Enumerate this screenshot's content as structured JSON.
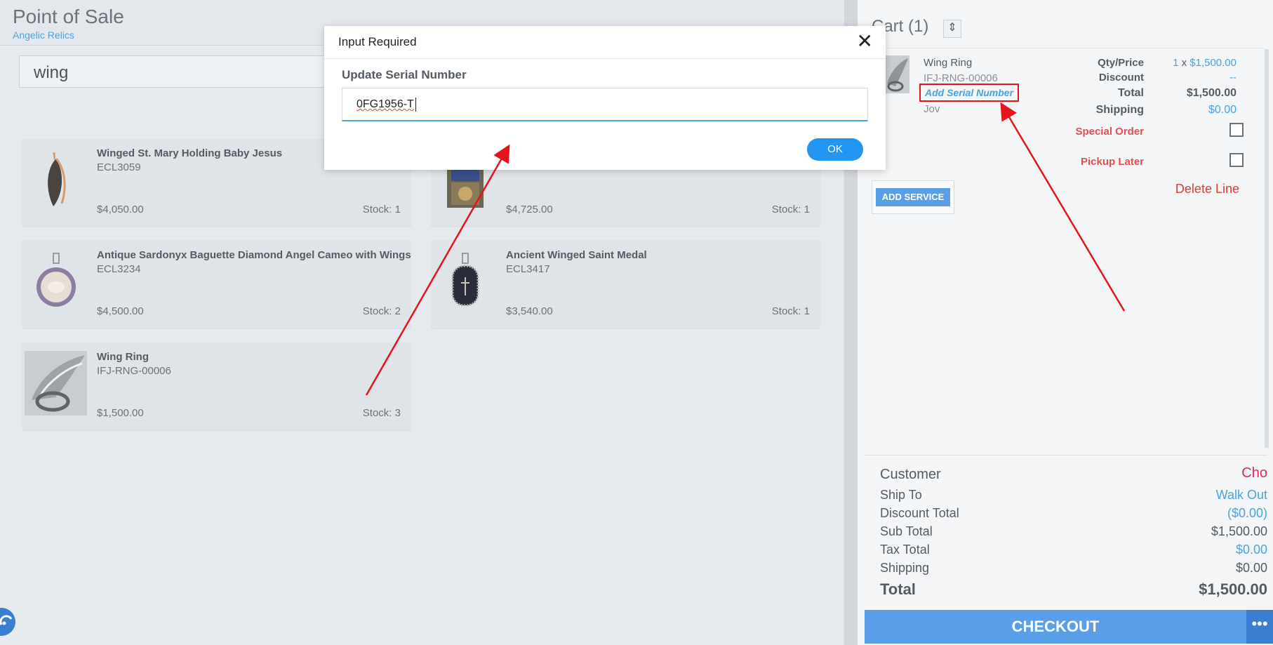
{
  "header": {
    "title": "Point of Sale",
    "subtitle": "Angelic Relics"
  },
  "search": {
    "value": "wing"
  },
  "products": [
    {
      "name": "Winged St. Mary Holding Baby Jesus",
      "sku": "ECL3059",
      "price": "$4,050.00",
      "stock": "Stock: 1",
      "image": "winged-pendant-image"
    },
    {
      "name": "",
      "sku": "",
      "price": "$4,725.00",
      "stock": "Stock: 1",
      "image": "icon-pendant-image"
    },
    {
      "name": "Antique Sardonyx Baguette Diamond Angel Cameo with Wings",
      "sku": "ECL3234",
      "price": "$4,500.00",
      "stock": "Stock: 2",
      "image": "cameo-pendant-image"
    },
    {
      "name": "Ancient Winged Saint Medal",
      "sku": "ECL3417",
      "price": "$3,540.00",
      "stock": "Stock: 1",
      "image": "saint-medal-image"
    },
    {
      "name": "Wing Ring",
      "sku": "IFJ-RNG-00006",
      "price": "$1,500.00",
      "stock": "Stock: 3",
      "image": "wing-ring-image"
    }
  ],
  "cart": {
    "title": "Cart (1)",
    "line": {
      "name": "Wing Ring",
      "sku": "IFJ-RNG-00006",
      "add_serial": "Add Serial Number",
      "vendor": "Jov",
      "qty_price_label": "Qty/Price",
      "qty": "1",
      "times": "x",
      "unit_price": "$1,500.00",
      "discount_label": "Discount",
      "discount_value": "--",
      "total_label": "Total",
      "total_value": "$1,500.00",
      "shipping_label": "Shipping",
      "shipping_value": "$0.00",
      "special_order_label": "Special Order",
      "pickup_later_label": "Pickup Later",
      "add_service": "ADD SERVICE",
      "delete_line": "Delete Line"
    },
    "summary": {
      "customer_label": "Customer",
      "customer_value": "Cho",
      "ship_to_label": "Ship To",
      "ship_to_value": "Walk Out",
      "discount_total_label": "Discount Total",
      "discount_total_value": "($0.00)",
      "sub_total_label": "Sub Total",
      "sub_total_value": "$1,500.00",
      "tax_total_label": "Tax Total",
      "tax_total_value": "$0.00",
      "shipping_label": "Shipping",
      "shipping_value": "$0.00",
      "total_label": "Total",
      "total_value": "$1,500.00"
    },
    "checkout": "CHECKOUT",
    "more": "•••"
  },
  "modal": {
    "title": "Input Required",
    "close": "✕",
    "field_label": "Update Serial Number",
    "field_value": "0FG1956-T",
    "ok": "OK"
  },
  "colors": {
    "accent": "#4aa3df",
    "checkout": "#5b9ee8",
    "ok_button": "#2196f3",
    "danger": "#e03a3a",
    "annotation": "#e8121b"
  }
}
